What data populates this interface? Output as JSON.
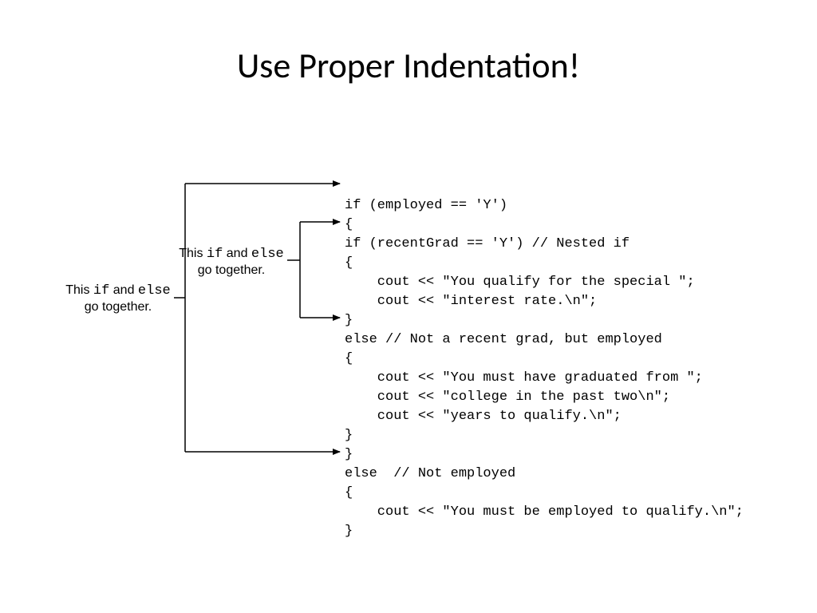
{
  "title": "Use Proper Indentation!",
  "note_outer_prefix": "This ",
  "note_outer_if": "if",
  "note_outer_mid": " and ",
  "note_outer_else": "else",
  "note_outer_suffix": "go together.",
  "note_inner_prefix": "This ",
  "note_inner_if": "if",
  "note_inner_mid": " and ",
  "note_inner_else": "else",
  "note_inner_suffix": "go together.",
  "code": {
    "l1": "if (employed == 'Y')",
    "l2": "{",
    "l3": "if (recentGrad == 'Y') // Nested if",
    "l4": "{",
    "l5": "    cout << \"You qualify for the special \";",
    "l6": "    cout << \"interest rate.\\n\";",
    "l7": "}",
    "l8": "else // Not a recent grad, but employed",
    "l9": "{",
    "l10": "    cout << \"You must have graduated from \";",
    "l11": "    cout << \"college in the past two\\n\";",
    "l12": "    cout << \"years to qualify.\\n\";",
    "l13": "}",
    "l14": "}",
    "l15": "else  // Not employed",
    "l16": "{",
    "l17": "    cout << \"You must be employed to qualify.\\n\";",
    "l18": "}"
  }
}
